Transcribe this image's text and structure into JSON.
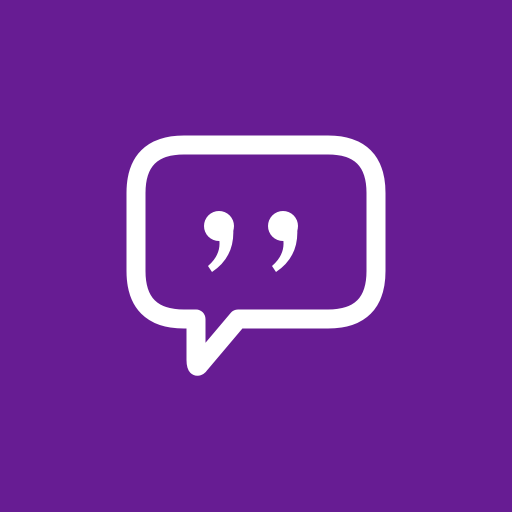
{
  "icon": {
    "name": "quote-speech-bubble-icon",
    "background_color": "#671C93",
    "foreground_color": "#FFFFFF"
  }
}
